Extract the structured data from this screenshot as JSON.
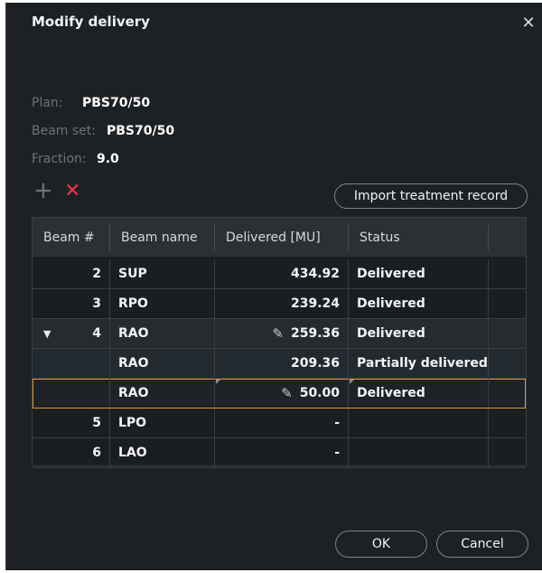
{
  "dialog": {
    "title": "Modify delivery",
    "close_icon": "close-icon"
  },
  "info": {
    "plan_label": "Plan:",
    "plan_value": "PBS70/50",
    "beamset_label": "Beam set:",
    "beamset_value": "PBS70/50",
    "fraction_label": "Fraction:",
    "fraction_value": "9.0"
  },
  "toolbar": {
    "add_icon": "plus-icon",
    "delete_icon": "delete-x-icon",
    "import_label": "Import treatment record"
  },
  "table": {
    "headers": [
      "Beam #",
      "Beam name",
      "Delivered [MU]",
      "Status"
    ],
    "rows": [
      {
        "beam": "2",
        "name": "SUP",
        "delivered": "434.92",
        "status": "Delivered"
      },
      {
        "beam": "3",
        "name": "RPO",
        "delivered": "239.24",
        "status": "Delivered"
      },
      {
        "beam": "4",
        "name": "RAO",
        "delivered": "259.36",
        "status": "Delivered",
        "expanded": true,
        "editable": true
      },
      {
        "beam": "",
        "name": "RAO",
        "delivered": "209.36",
        "status": "Partially delivered"
      },
      {
        "beam": "",
        "name": "RAO",
        "delivered": "50.00",
        "status": "Delivered",
        "selected": true,
        "editable": true
      },
      {
        "beam": "5",
        "name": "LPO",
        "delivered": "-",
        "status": ""
      },
      {
        "beam": "6",
        "name": "LAO",
        "delivered": "-",
        "status": ""
      }
    ]
  },
  "footer": {
    "ok_label": "OK",
    "cancel_label": "Cancel"
  }
}
